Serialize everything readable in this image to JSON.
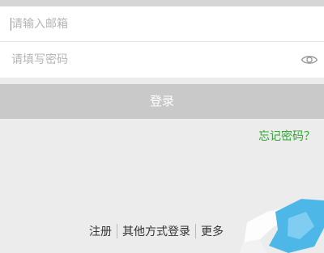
{
  "email_field": {
    "placeholder": "请输入邮箱",
    "value": ""
  },
  "password_field": {
    "placeholder": "请填写密码",
    "value": "",
    "toggle_icon": "eye-icon"
  },
  "login_button": {
    "label": "登录"
  },
  "forgot_link": {
    "label": "忘记密码？"
  },
  "bottom_links": [
    {
      "label": "注册"
    },
    {
      "label": "其他方式登录"
    },
    {
      "label": "更多"
    }
  ],
  "colors": {
    "background": "#ececec",
    "accent_green": "#2aa92a",
    "button_disabled": "#c9c9c9",
    "overlay_blue": "#4db8e8"
  }
}
